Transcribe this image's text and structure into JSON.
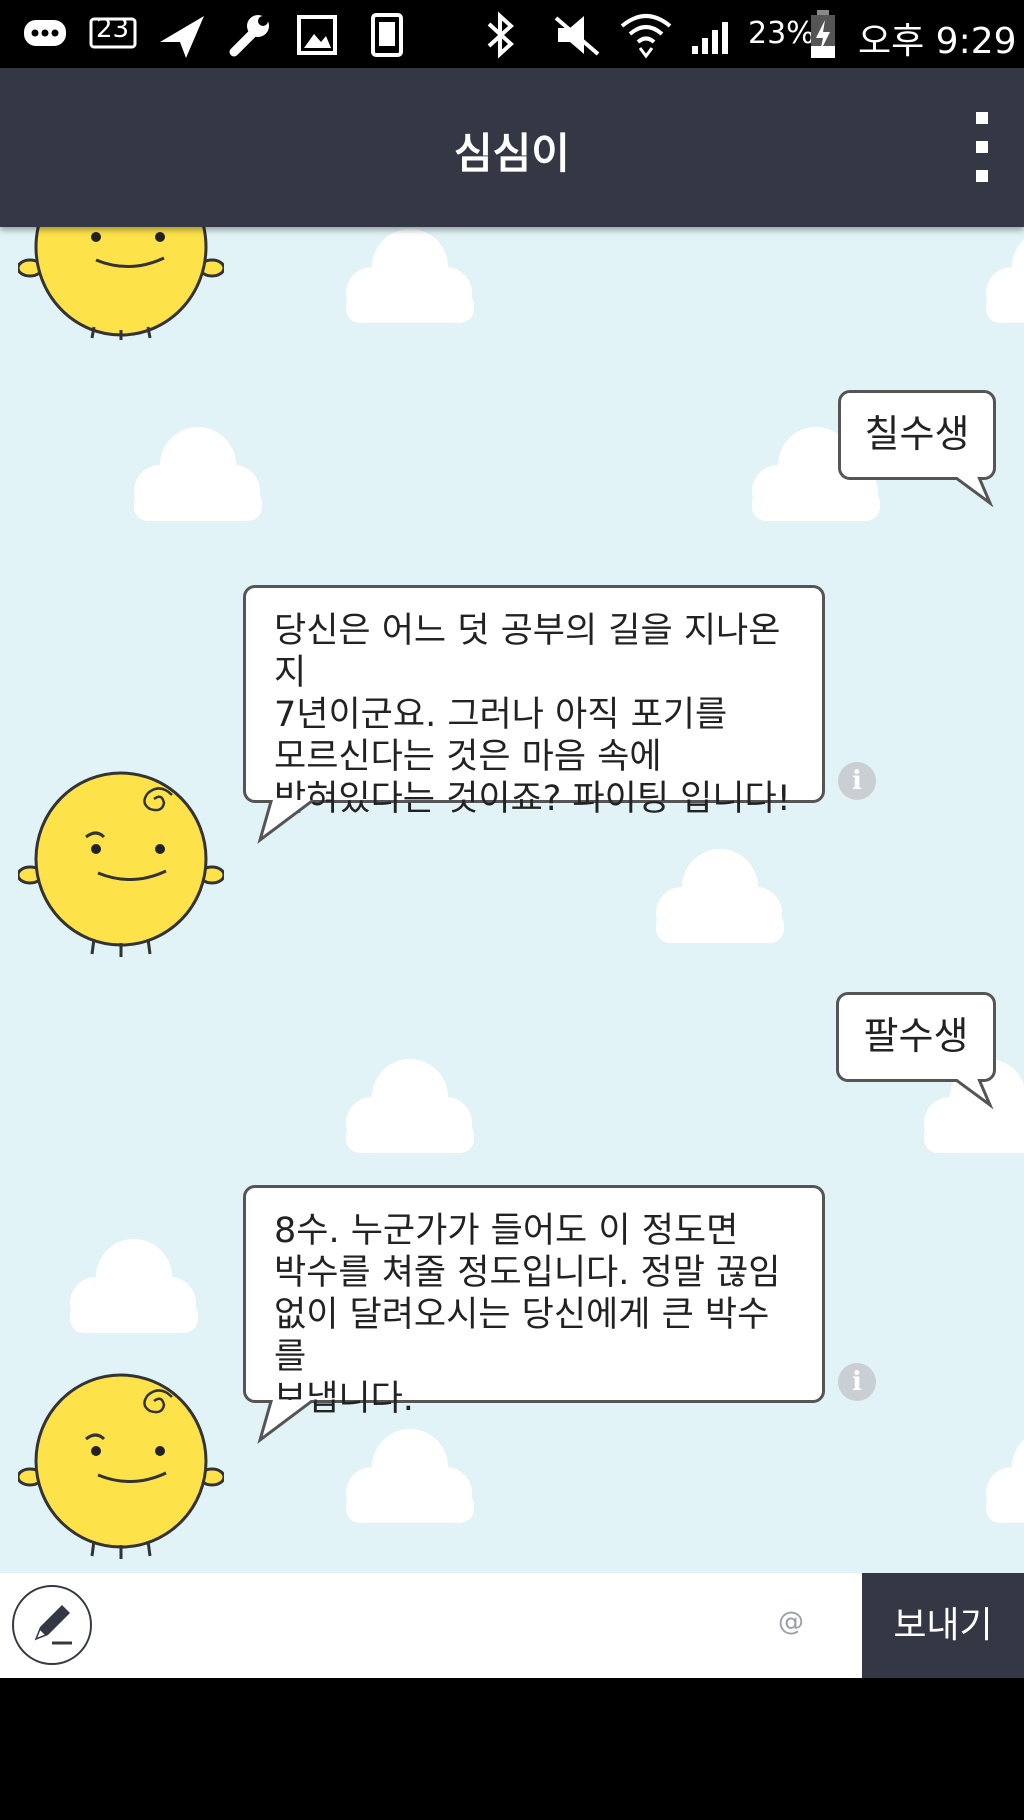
{
  "status_bar": {
    "notification_count": "23",
    "battery": "23%",
    "time": "오후 9:29",
    "icons": [
      "messages-icon",
      "notification-count-icon",
      "navigation-icon",
      "wrench-icon",
      "image-icon",
      "phone-icon",
      "bluetooth-icon",
      "mute-icon",
      "wifi-icon",
      "signal-icon",
      "battery-icon"
    ]
  },
  "app_bar": {
    "title": "심심이",
    "menu_icon": "overflow-menu-icon"
  },
  "messages": [
    {
      "sender": "user",
      "text": "칠수생"
    },
    {
      "sender": "bot",
      "text": "당신은 어느 덧 공부의 길을 지나온지\n7년이군요. 그러나 아직 포기를\n모르신다는 것은 마음 속에\n박혀있다는 것이죠? 파이팅 입니다!"
    },
    {
      "sender": "user",
      "text": "팔수생"
    },
    {
      "sender": "bot",
      "text": "8수. 누군가가 들어도 이 정도면\n박수를 쳐줄 정도입니다. 정말 끊임\n없이 달려오시는 당신에게 큰 박수를\n보냅니다."
    }
  ],
  "input": {
    "value": "",
    "placeholder": "",
    "at_symbol": "@",
    "send_label": "보내기"
  },
  "colors": {
    "app_bar": "#343844",
    "chat_background": "#e1f3f6",
    "avatar": "#fde24a",
    "send_button": "#343844"
  }
}
